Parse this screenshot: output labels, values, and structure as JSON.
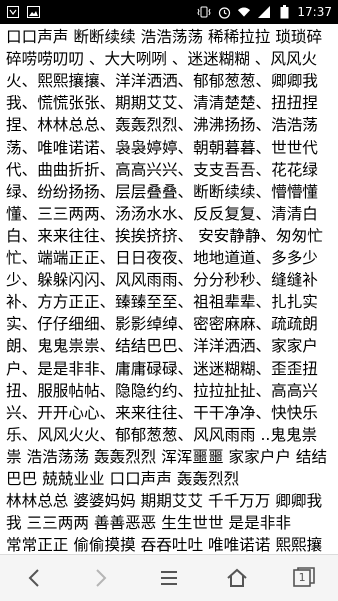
{
  "status_bar": {
    "time": "17:37",
    "icons": [
      "notification-icon",
      "image-icon",
      "vibrate-icon",
      "alarm-icon",
      "wifi-icon",
      "signal-icon",
      "battery-icon"
    ]
  },
  "article": {
    "lines": [
      "口口声声 断断续续 浩浩荡荡 稀稀拉拉 琐琐碎",
      "碎唠唠叨叨 、大大咧咧 、迷迷糊糊 、风风火",
      "火、熙熙攘攘、洋洋洒洒、郁郁葱葱、卿卿我",
      "我、慌慌张张、期期艾艾、清清楚楚、扭扭捏",
      "捏、林林总总、轰轰烈烈、沸沸扬扬、浩浩荡",
      "荡、唯唯诺诺、袅袅婷婷、朝朝暮暮、世世代",
      "代、曲曲折折、高高兴兴、支支吾吾、花花绿",
      "绿、纷纷扬扬、层层叠叠、断断续续、懵懵懂",
      "懂、三三两两、汤汤水水、反反复复、清清白",
      "白、来来往往、挨挨挤挤、 安安静静、匆匆忙",
      "忙、端端正正、日日夜夜、地地道道、多多少",
      "少、躲躲闪闪、风风雨雨、分分秒秒、缝缝补",
      "补、方方正正、臻臻至至、祖祖辈辈、扎扎实",
      "实、仔仔细细、影影绰绰、密密麻麻、疏疏朗",
      "朗、鬼鬼祟祟、结结巴巴、洋洋洒洒、家家户",
      "户、是是非非、庸庸碌碌、迷迷糊糊、歪歪扭",
      "扭、服服帖帖、隐隐约约、拉拉扯扯、高高兴",
      "兴、开开心心、来来往往、干干净净、快快乐",
      "乐、风风火火、郁郁葱葱、风风雨雨 ..鬼鬼祟",
      "祟 浩浩荡荡 轰轰烈烈 浑浑噩噩 家家户户 结结",
      "巴巴 兢兢业业 口口声声 轰轰烈烈",
      "林林总总 婆婆妈妈 期期艾艾 千千万万 卿卿我",
      "我 三三两两 善善恶恶 生生世世 是是非非",
      "常常正正 偷偷摸摸 吞吞吐吐 唯唯诺诺 熙熙攘"
    ]
  },
  "nav_bar": {
    "tab_count": "1",
    "buttons": [
      "back-icon",
      "forward-icon",
      "menu-icon",
      "home-icon",
      "tabs-icon"
    ]
  }
}
